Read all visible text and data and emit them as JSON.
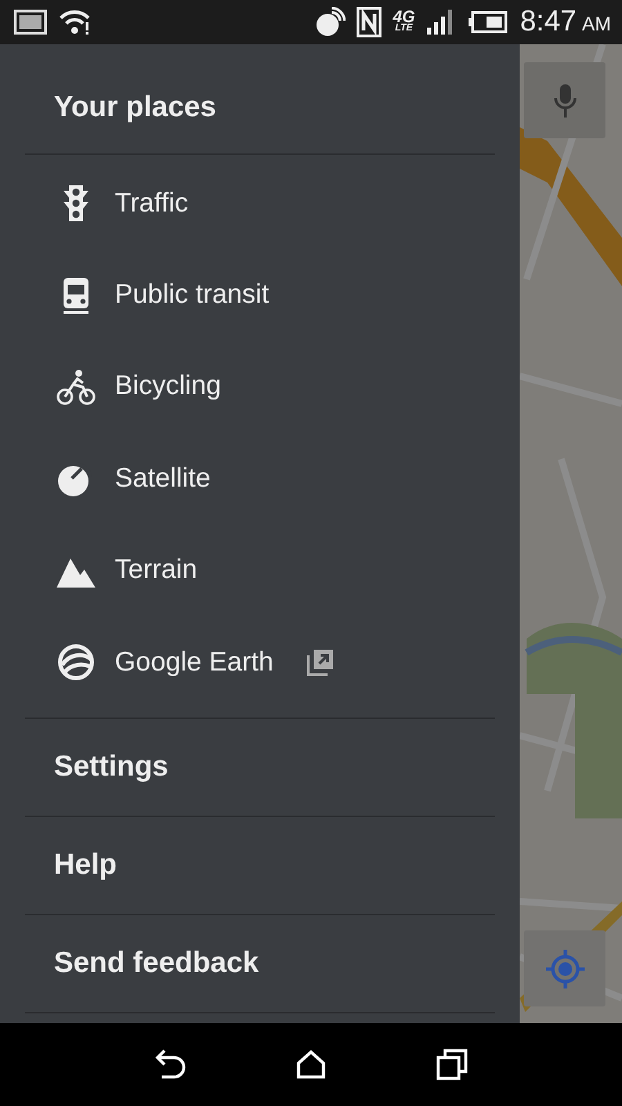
{
  "status_bar": {
    "network": "4G",
    "network_sub": "LTE",
    "time": "8:47",
    "am_pm": "AM"
  },
  "drawer": {
    "header": "Your places",
    "layers": [
      {
        "label": "Traffic",
        "external": false
      },
      {
        "label": "Public transit",
        "external": false
      },
      {
        "label": "Bicycling",
        "external": false
      },
      {
        "label": "Satellite",
        "external": false
      },
      {
        "label": "Terrain",
        "external": false
      },
      {
        "label": "Google Earth",
        "external": true
      }
    ],
    "links": [
      "Settings",
      "Help",
      "Send feedback"
    ]
  }
}
